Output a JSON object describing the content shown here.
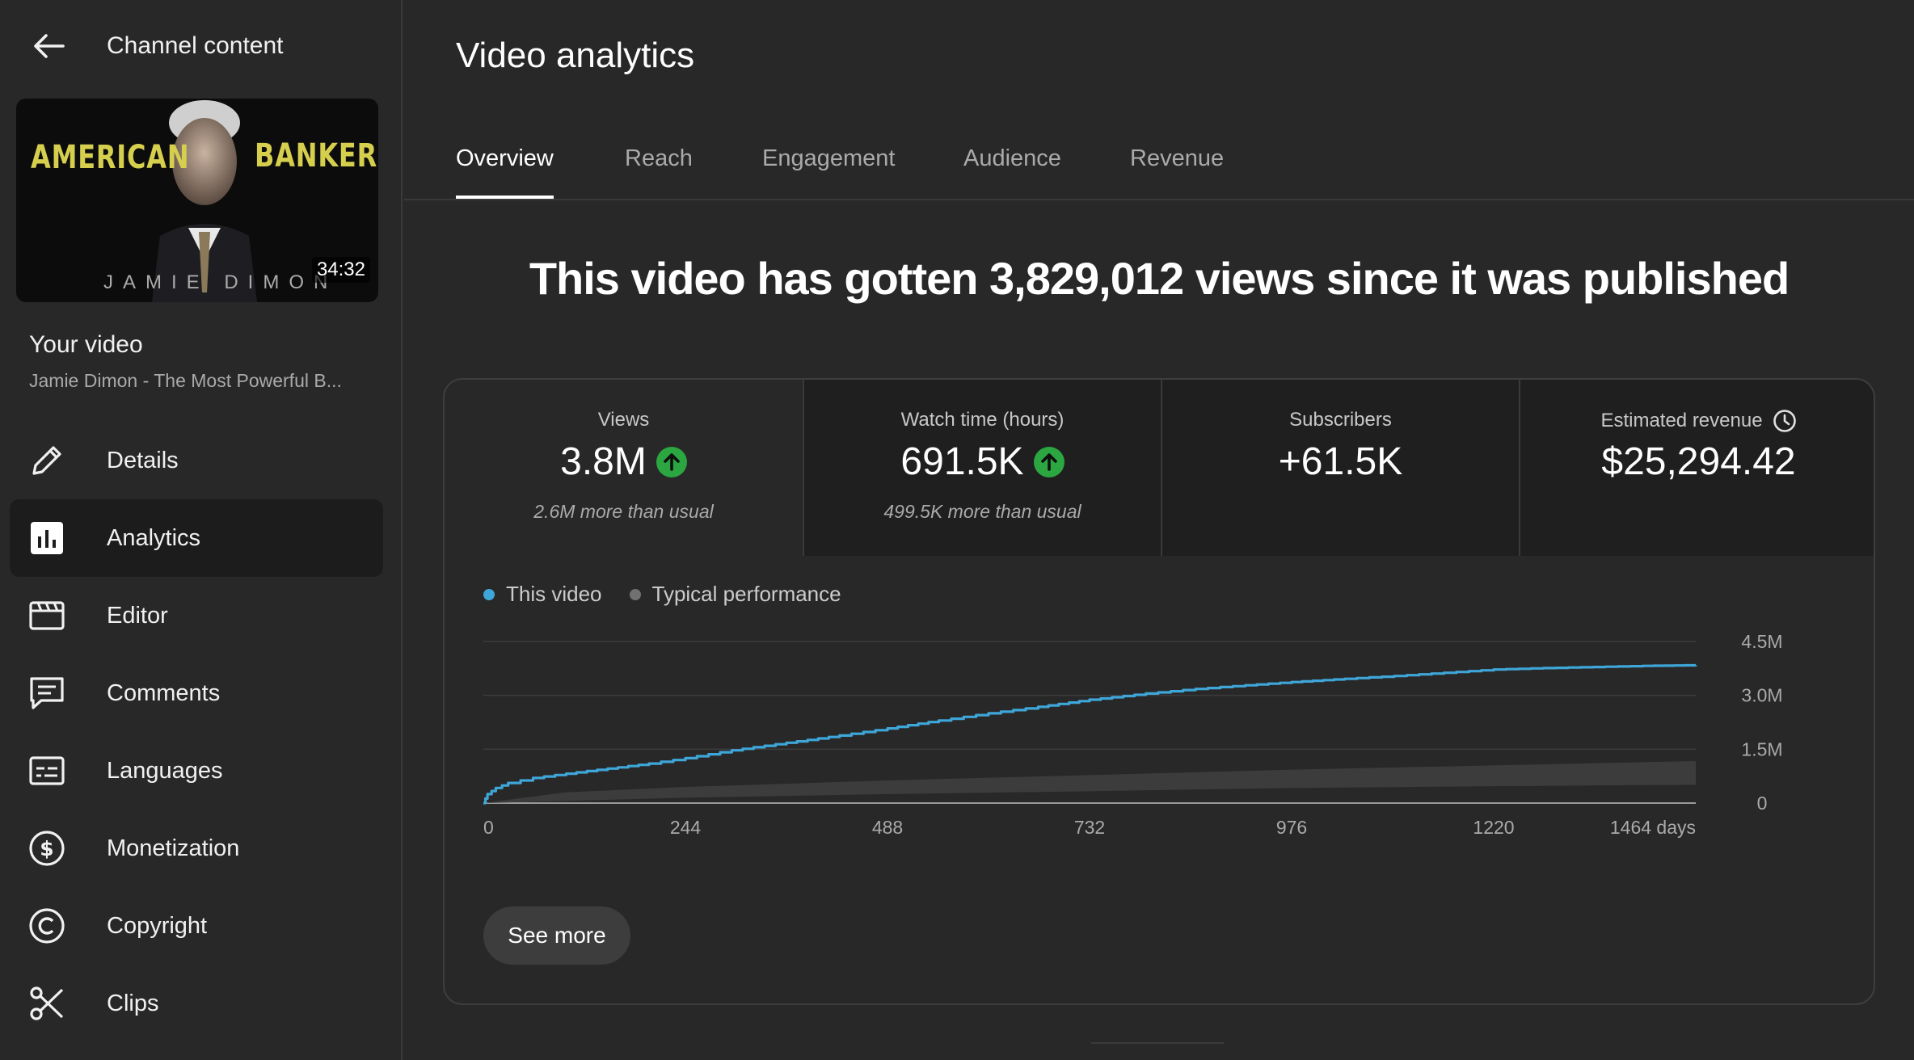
{
  "sidebar": {
    "header_title": "Channel content",
    "thumbnail": {
      "title_left": "AMERICAN",
      "title_right": "BANKER",
      "subtitle": "JAMIE DIMON",
      "duration": "34:32"
    },
    "your_video_label": "Your video",
    "video_title": "Jamie Dimon - The Most Powerful B...",
    "items": [
      {
        "label": "Details",
        "icon": "pencil-icon",
        "active": false
      },
      {
        "label": "Analytics",
        "icon": "analytics-icon",
        "active": true
      },
      {
        "label": "Editor",
        "icon": "clapperboard-icon",
        "active": false
      },
      {
        "label": "Comments",
        "icon": "comment-icon",
        "active": false
      },
      {
        "label": "Languages",
        "icon": "subtitles-icon",
        "active": false
      },
      {
        "label": "Monetization",
        "icon": "dollar-circle-icon",
        "active": false
      },
      {
        "label": "Copyright",
        "icon": "copyright-icon",
        "active": false
      },
      {
        "label": "Clips",
        "icon": "scissors-icon",
        "active": false
      }
    ]
  },
  "main": {
    "title": "Video analytics",
    "tabs": [
      {
        "label": "Overview",
        "active": true
      },
      {
        "label": "Reach",
        "active": false
      },
      {
        "label": "Engagement",
        "active": false
      },
      {
        "label": "Audience",
        "active": false
      },
      {
        "label": "Revenue",
        "active": false
      }
    ],
    "headline": "This video has gotten 3,829,012 views since it was published",
    "metrics": [
      {
        "label": "Views",
        "value": "3.8M",
        "trend": "up",
        "note": "2.6M more than usual"
      },
      {
        "label": "Watch time (hours)",
        "value": "691.5K",
        "trend": "up",
        "note": "499.5K more than usual"
      },
      {
        "label": "Subscribers",
        "value": "+61.5K",
        "trend": "",
        "note": ""
      },
      {
        "label": "Estimated revenue",
        "value": "$25,294.42",
        "trend": "",
        "note": "",
        "label_icon": "clock-icon"
      }
    ],
    "legend": [
      {
        "label": "This video",
        "color": "#3ea6d8"
      },
      {
        "label": "Typical performance",
        "color": "#717171"
      }
    ],
    "see_more_label": "See more"
  },
  "colors": {
    "accent_line": "#3ea6d8",
    "up_badge": "#2ba640",
    "band": "#3c3c3c"
  },
  "chart_data": {
    "type": "line",
    "x_ticks": [
      "0",
      "244",
      "488",
      "732",
      "976",
      "1220",
      "1464 days"
    ],
    "y_ticks": [
      "0",
      "1.5M",
      "3.0M",
      "4.5M"
    ],
    "xlim": [
      0,
      1464
    ],
    "ylim": [
      0,
      4500000
    ],
    "series": [
      {
        "name": "This video",
        "x": [
          0,
          5,
          15,
          30,
          60,
          100,
          150,
          200,
          244,
          300,
          366,
          430,
          488,
          550,
          610,
          670,
          732,
          800,
          860,
          920,
          976,
          1040,
          1100,
          1160,
          1220,
          1280,
          1340,
          1400,
          1464
        ],
        "values": [
          0,
          250000,
          420000,
          560000,
          700000,
          820000,
          960000,
          1100000,
          1250000,
          1470000,
          1680000,
          1880000,
          2080000,
          2300000,
          2500000,
          2680000,
          2880000,
          3050000,
          3180000,
          3280000,
          3370000,
          3460000,
          3540000,
          3630000,
          3720000,
          3760000,
          3790000,
          3820000,
          3840000
        ]
      },
      {
        "name": "Typical performance",
        "x": [
          0,
          100,
          244,
          488,
          732,
          976,
          1220,
          1464
        ],
        "upper": [
          0,
          300000,
          450000,
          630000,
          780000,
          930000,
          1050000,
          1170000
        ],
        "lower": [
          0,
          60000,
          150000,
          250000,
          330000,
          420000,
          470000,
          510000
        ]
      }
    ]
  }
}
